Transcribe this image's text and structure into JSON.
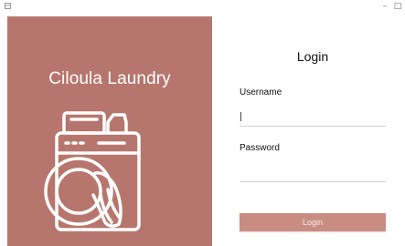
{
  "window": {
    "minimize_glyph": "–",
    "maximize_glyph": "□"
  },
  "brand": {
    "name": "Ciloula Laundry"
  },
  "login": {
    "title": "Login",
    "username_label": "Username",
    "username_value": "",
    "password_label": "Password",
    "password_value": "",
    "button_label": "Login"
  },
  "colors": {
    "panel": "#b7766d",
    "button": "#c98c83",
    "illustration_stroke": "#ffffff"
  },
  "icons": [
    "app-icon",
    "washing-machine-icon"
  ]
}
